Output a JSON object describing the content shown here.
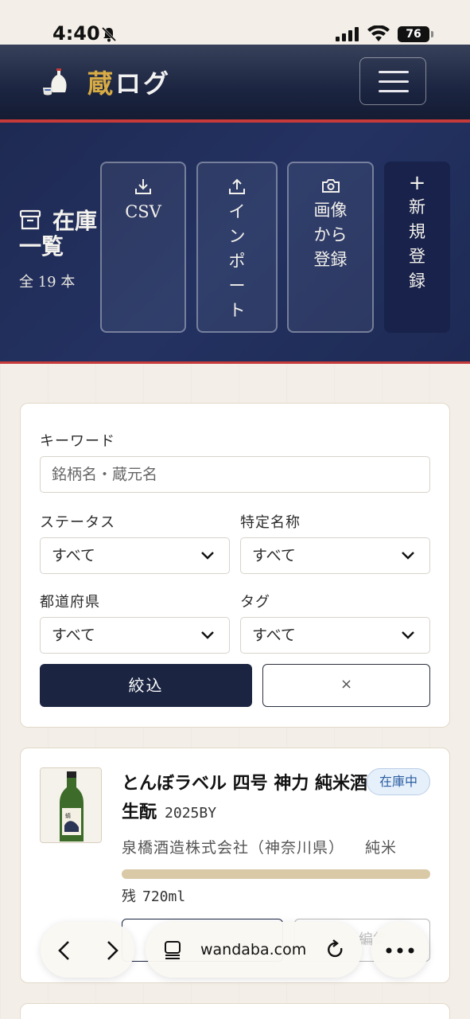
{
  "status_bar": {
    "time": "4:40",
    "battery": "76"
  },
  "header": {
    "logo_accent": "蔵",
    "logo_rest": "ログ"
  },
  "hero": {
    "title": "在庫一覧",
    "count": "全 19 本",
    "buttons": {
      "csv": "CSV",
      "import": [
        "イ",
        "ン",
        "ポ",
        "ー",
        "ト"
      ],
      "image": [
        "画像",
        "から",
        "登録"
      ],
      "new_plus": "+",
      "new": [
        "新",
        "規",
        "登",
        "録"
      ]
    }
  },
  "filter": {
    "keyword_label": "キーワード",
    "keyword_placeholder": "銘柄名・蔵元名",
    "status_label": "ステータス",
    "status_value": "すべて",
    "grade_label": "特定名称",
    "grade_value": "すべて",
    "prefecture_label": "都道府県",
    "prefecture_value": "すべて",
    "tag_label": "タグ",
    "tag_value": "すべて",
    "apply_label": "絞込",
    "clear_label": "×"
  },
  "item": {
    "name": "とんぼラベル 四号 神力 純米酒 生酛",
    "brewing_year": "2025BY",
    "status": "在庫中",
    "brewery": "泉橋酒造株式会社（神奈川県）",
    "grade": "純米",
    "remaining_label": "残",
    "remaining_value": "720ml",
    "remaining_fraction": 1.0,
    "edit_label": "編集"
  },
  "browser": {
    "url": "wandaba.com"
  },
  "colors": {
    "navy": "#1b2441",
    "accent_red": "#c63a3a",
    "gold": "#d8ac45",
    "badge_blue": "#2b5ea0"
  }
}
